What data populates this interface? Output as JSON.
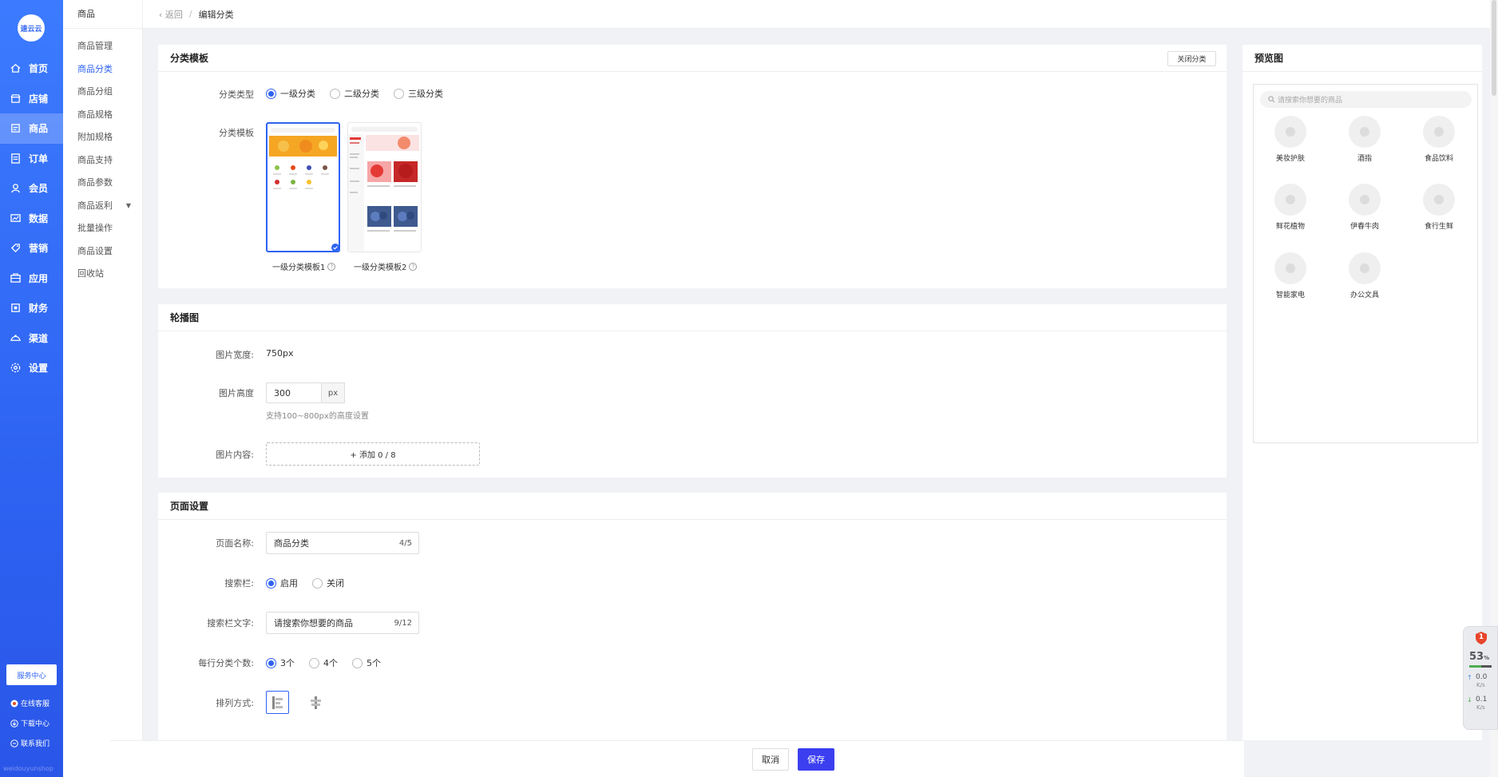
{
  "brand": {
    "logo_text": "速云云",
    "watermark": "weidouyunshop"
  },
  "nav": {
    "items": [
      {
        "label": "首页",
        "icon": "home-icon"
      },
      {
        "label": "店铺",
        "icon": "shop-icon"
      },
      {
        "label": "商品",
        "icon": "goods-icon",
        "active": true
      },
      {
        "label": "订单",
        "icon": "order-icon"
      },
      {
        "label": "会员",
        "icon": "member-icon"
      },
      {
        "label": "数据",
        "icon": "data-icon"
      },
      {
        "label": "营销",
        "icon": "marketing-icon"
      },
      {
        "label": "应用",
        "icon": "app-icon"
      },
      {
        "label": "财务",
        "icon": "finance-icon"
      },
      {
        "label": "渠道",
        "icon": "channel-icon"
      },
      {
        "label": "设置",
        "icon": "settings-icon"
      }
    ],
    "service_center": "服务中心",
    "online_service": "在线客服",
    "download_center": "下载中心",
    "contact_us": "联系我们"
  },
  "subnav": {
    "title": "商品",
    "items": [
      "商品管理",
      "商品分类",
      "商品分组",
      "商品规格",
      "附加规格",
      "商品支持",
      "商品参数",
      "商品返利",
      "批量操作",
      "商品设置",
      "回收站"
    ]
  },
  "breadcrumb": {
    "back": "返回",
    "current": "编辑分类"
  },
  "template_card": {
    "title": "分类模板",
    "close_button": "关闭分类",
    "type_label": "分类类型",
    "type_options": [
      "一级分类",
      "二级分类",
      "三级分类"
    ],
    "template_label": "分类模板",
    "templates": [
      "一级分类模板1",
      "一级分类模板2"
    ]
  },
  "carousel_card": {
    "title": "轮播图",
    "width_label": "图片宽度:",
    "width_value": "750px",
    "height_label": "图片高度",
    "height_value": "300",
    "height_unit": "px",
    "height_hint": "支持100~800px的高度设置",
    "content_label": "图片内容:",
    "add_button": "+ 添加 0 / 8"
  },
  "page_card": {
    "title": "页面设置",
    "name_label": "页面名称:",
    "name_value": "商品分类",
    "name_count": "4/5",
    "search_label": "搜索栏:",
    "search_options": [
      "启用",
      "关闭"
    ],
    "search_text_label": "搜索栏文字:",
    "search_text_value": "请搜索你想要的商品",
    "search_text_count": "9/12",
    "per_row_label": "每行分类个数:",
    "per_row_options": [
      "3个",
      "4个",
      "5个"
    ],
    "sort_label": "排列方式:"
  },
  "preview": {
    "title": "预览图",
    "search_placeholder": "请搜索你想要的商品",
    "items": [
      "美妆护肤",
      "酒指",
      "食品饮料",
      "鲜花植物",
      "伊春牛肉",
      "食行生鲜",
      "智能家电",
      "办公文具"
    ]
  },
  "footer": {
    "cancel": "取消",
    "save": "保存"
  },
  "widget": {
    "badge": "1",
    "percent": "53",
    "percent_unit": "%",
    "up_value": "0.0",
    "up_unit": "K/s",
    "down_value": "0.1",
    "down_unit": "K/s"
  },
  "colors": {
    "primary": "#2e63f2",
    "sidebar_top": "#3c7bff",
    "save_button": "#3b3ff0"
  }
}
